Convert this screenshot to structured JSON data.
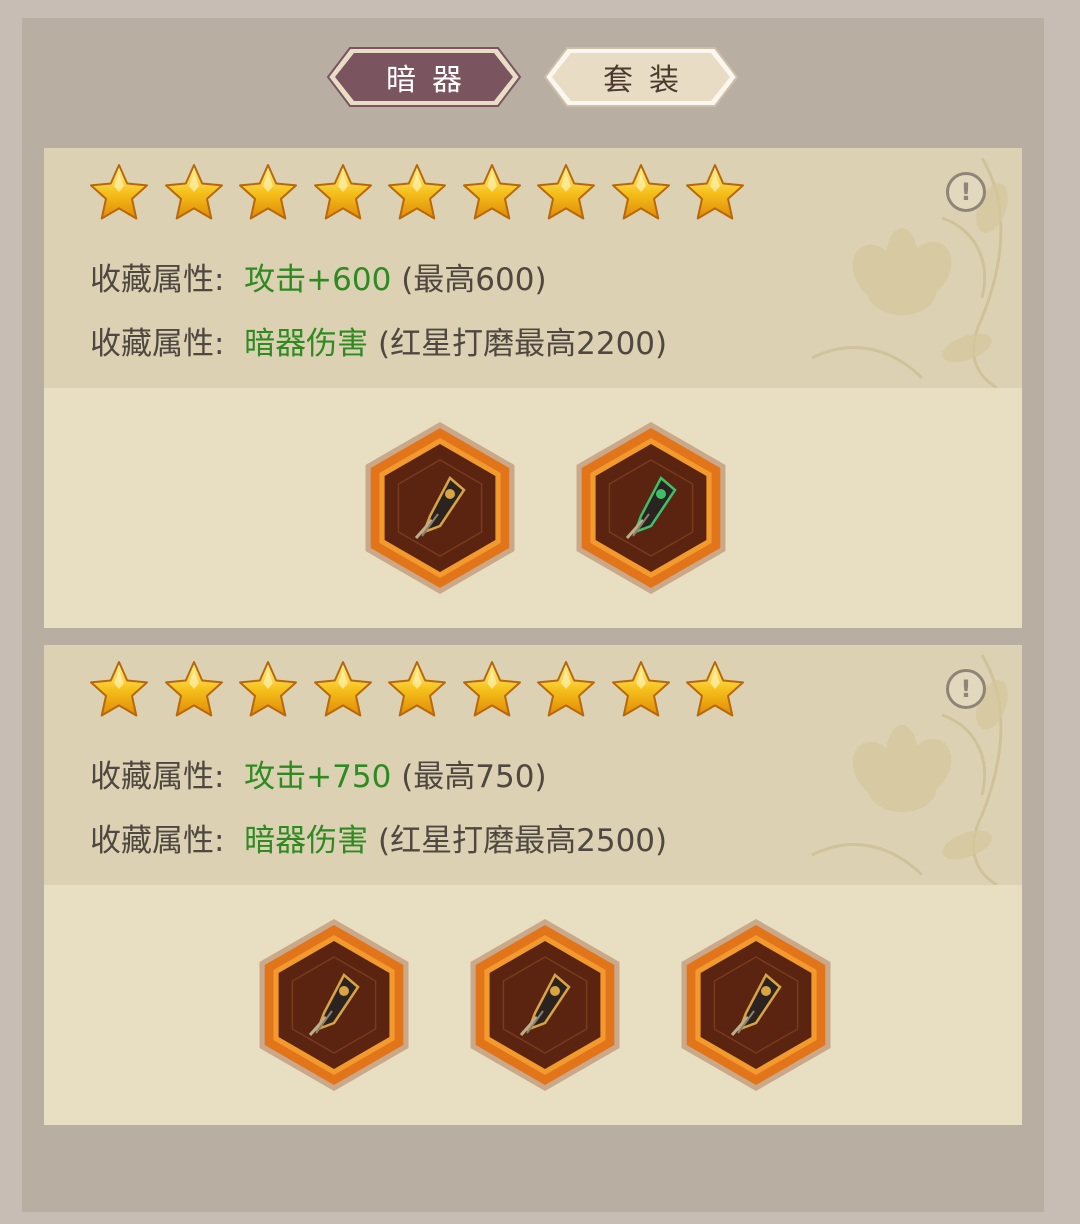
{
  "tabs": [
    {
      "label": "暗器",
      "active": true
    },
    {
      "label": "套装",
      "active": false
    }
  ],
  "colors": {
    "tab_active": "#7a5560",
    "tab_inactive": "#efe6d0",
    "value_green": "#2f8a22",
    "hex_orange": "#e2741a",
    "hex_inner": "#5a2410"
  },
  "cards": [
    {
      "stars": 9,
      "info_icon": "!",
      "attributes": [
        {
          "label": "收藏属性:",
          "value": "攻击+600",
          "note": "(最高600)"
        },
        {
          "label": "收藏属性:",
          "value": "暗器伤害",
          "note": "(红星打磨最高2200)"
        }
      ],
      "items": [
        {
          "icon": "dark-spiked-gauntlet-icon"
        },
        {
          "icon": "jade-feather-bracer-icon"
        }
      ]
    },
    {
      "stars": 9,
      "info_icon": "!",
      "attributes": [
        {
          "label": "收藏属性:",
          "value": "攻击+750",
          "note": "(最高750)"
        },
        {
          "label": "收藏属性:",
          "value": "暗器伤害",
          "note": "(红星打磨最高2500)"
        }
      ],
      "items": [
        {
          "icon": "black-gold-blade-launcher-icon"
        },
        {
          "icon": "bronze-scroll-dart-icon"
        },
        {
          "icon": "golden-dragon-claw-icon"
        }
      ]
    }
  ]
}
